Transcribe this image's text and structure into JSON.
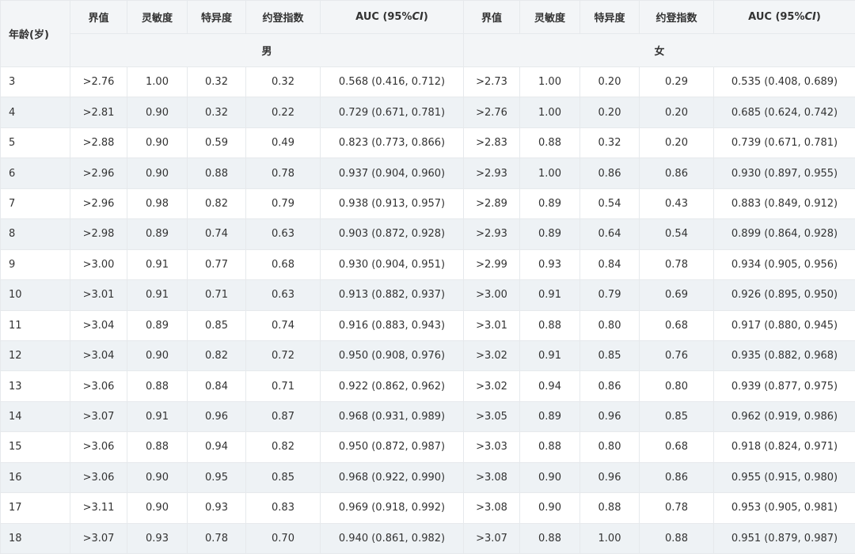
{
  "header": {
    "age_label": "年龄(岁)",
    "cols": [
      "界值",
      "灵敏度",
      "特异度",
      "约登指数"
    ],
    "auc_prefix": "AUC (95%",
    "auc_ci": "CI",
    "auc_suffix": ")",
    "male_label": "男",
    "female_label": "女"
  },
  "rows": [
    {
      "age": "3",
      "m": [
        ">2.76",
        "1.00",
        "0.32",
        "0.32",
        "0.568 (0.416, 0.712)"
      ],
      "f": [
        ">2.73",
        "1.00",
        "0.20",
        "0.29",
        "0.535 (0.408, 0.689)"
      ]
    },
    {
      "age": "4",
      "m": [
        ">2.81",
        "0.90",
        "0.32",
        "0.22",
        "0.729 (0.671, 0.781)"
      ],
      "f": [
        ">2.76",
        "1.00",
        "0.20",
        "0.20",
        "0.685 (0.624, 0.742)"
      ]
    },
    {
      "age": "5",
      "m": [
        ">2.88",
        "0.90",
        "0.59",
        "0.49",
        "0.823 (0.773, 0.866)"
      ],
      "f": [
        ">2.83",
        "0.88",
        "0.32",
        "0.20",
        "0.739 (0.671, 0.781)"
      ]
    },
    {
      "age": "6",
      "m": [
        ">2.96",
        "0.90",
        "0.88",
        "0.78",
        "0.937 (0.904, 0.960)"
      ],
      "f": [
        ">2.93",
        "1.00",
        "0.86",
        "0.86",
        "0.930 (0.897, 0.955)"
      ]
    },
    {
      "age": "7",
      "m": [
        ">2.96",
        "0.98",
        "0.82",
        "0.79",
        "0.938 (0.913, 0.957)"
      ],
      "f": [
        ">2.89",
        "0.89",
        "0.54",
        "0.43",
        "0.883 (0.849, 0.912)"
      ]
    },
    {
      "age": "8",
      "m": [
        ">2.98",
        "0.89",
        "0.74",
        "0.63",
        "0.903 (0.872, 0.928)"
      ],
      "f": [
        ">2.93",
        "0.89",
        "0.64",
        "0.54",
        "0.899 (0.864, 0.928)"
      ]
    },
    {
      "age": "9",
      "m": [
        ">3.00",
        "0.91",
        "0.77",
        "0.68",
        "0.930 (0.904, 0.951)"
      ],
      "f": [
        ">2.99",
        "0.93",
        "0.84",
        "0.78",
        "0.934 (0.905, 0.956)"
      ]
    },
    {
      "age": "10",
      "m": [
        ">3.01",
        "0.91",
        "0.71",
        "0.63",
        "0.913 (0.882, 0.937)"
      ],
      "f": [
        ">3.00",
        "0.91",
        "0.79",
        "0.69",
        "0.926 (0.895, 0.950)"
      ]
    },
    {
      "age": "11",
      "m": [
        ">3.04",
        "0.89",
        "0.85",
        "0.74",
        "0.916 (0.883, 0.943)"
      ],
      "f": [
        ">3.01",
        "0.88",
        "0.80",
        "0.68",
        "0.917 (0.880, 0.945)"
      ]
    },
    {
      "age": "12",
      "m": [
        ">3.04",
        "0.90",
        "0.82",
        "0.72",
        "0.950 (0.908, 0.976)"
      ],
      "f": [
        ">3.02",
        "0.91",
        "0.85",
        "0.76",
        "0.935 (0.882, 0.968)"
      ]
    },
    {
      "age": "13",
      "m": [
        ">3.06",
        "0.88",
        "0.84",
        "0.71",
        "0.922 (0.862, 0.962)"
      ],
      "f": [
        ">3.02",
        "0.94",
        "0.86",
        "0.80",
        "0.939 (0.877, 0.975)"
      ]
    },
    {
      "age": "14",
      "m": [
        ">3.07",
        "0.91",
        "0.96",
        "0.87",
        "0.968 (0.931, 0.989)"
      ],
      "f": [
        ">3.05",
        "0.89",
        "0.96",
        "0.85",
        "0.962 (0.919, 0.986)"
      ]
    },
    {
      "age": "15",
      "m": [
        ">3.06",
        "0.88",
        "0.94",
        "0.82",
        "0.950 (0.872, 0.987)"
      ],
      "f": [
        ">3.03",
        "0.88",
        "0.80",
        "0.68",
        "0.918 (0.824, 0.971)"
      ]
    },
    {
      "age": "16",
      "m": [
        ">3.06",
        "0.90",
        "0.95",
        "0.85",
        "0.968 (0.922, 0.990)"
      ],
      "f": [
        ">3.08",
        "0.90",
        "0.96",
        "0.86",
        "0.955 (0.915, 0.980)"
      ]
    },
    {
      "age": "17",
      "m": [
        ">3.11",
        "0.90",
        "0.93",
        "0.83",
        "0.969 (0.918, 0.992)"
      ],
      "f": [
        ">3.08",
        "0.90",
        "0.88",
        "0.78",
        "0.953 (0.905, 0.981)"
      ]
    },
    {
      "age": "18",
      "m": [
        ">3.07",
        "0.93",
        "0.78",
        "0.70",
        "0.940 (0.861, 0.982)"
      ],
      "f": [
        ">3.07",
        "0.88",
        "1.00",
        "0.88",
        "0.951 (0.879, 0.987)"
      ]
    }
  ]
}
